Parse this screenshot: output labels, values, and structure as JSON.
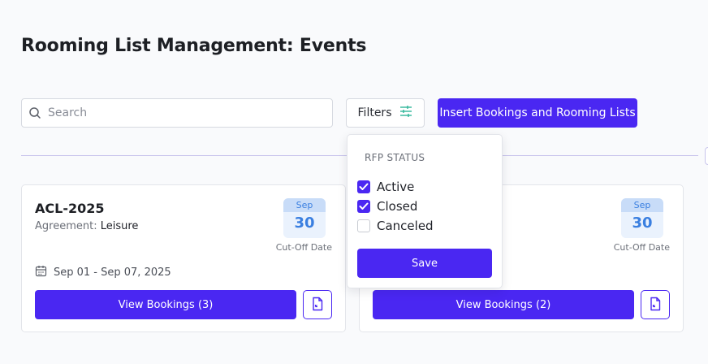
{
  "page": {
    "title": "Rooming List Management: Events"
  },
  "toolbar": {
    "search_placeholder": "Search",
    "filters_label": "Filters",
    "insert_label": "Insert Bookings and Rooming Lists"
  },
  "filters_dropdown": {
    "section_title": "RFP STATUS",
    "options": [
      {
        "label": "Active",
        "checked": true
      },
      {
        "label": "Closed",
        "checked": true
      },
      {
        "label": "Canceled",
        "checked": false
      }
    ],
    "save_label": "Save"
  },
  "cards": [
    {
      "name": "ACL-2025",
      "agreement_label": "Agreement:",
      "agreement_value": "Leisure",
      "cutoff_month": "Sep",
      "cutoff_day": "30",
      "cutoff_label": "Cut-Off Date",
      "date_range": "Sep 01 - Sep 07, 2025",
      "view_label": "View Bookings (3)"
    },
    {
      "cutoff_month": "Sep",
      "cutoff_day": "30",
      "cutoff_label": "Cut-Off Date",
      "view_label": "View Bookings (2)"
    }
  ],
  "colors": {
    "accent": "#4a27f2",
    "date_blue": "#3a7fe0",
    "filter_icon": "#2fb59a"
  }
}
